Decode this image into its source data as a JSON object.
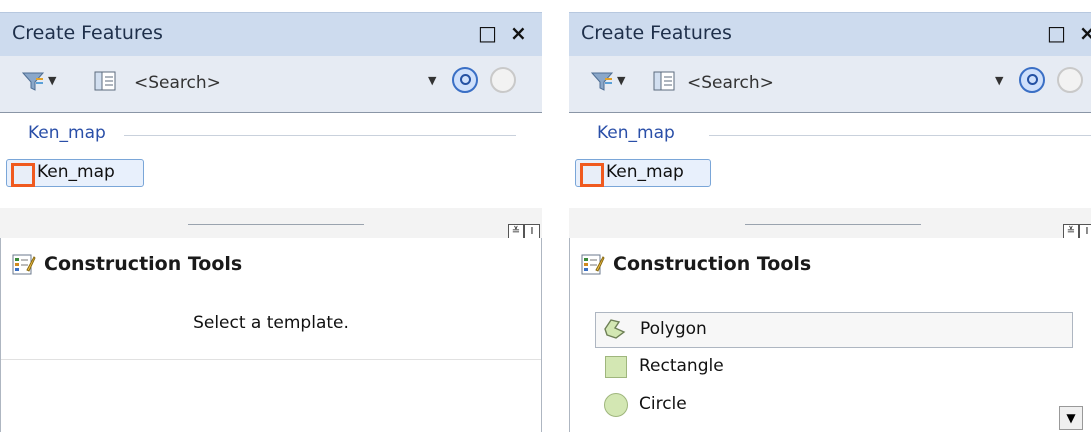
{
  "panels": [
    {
      "title": "Create Features",
      "restore_icon": "□",
      "close_icon": "×",
      "search": {
        "placeholder": "<Search>"
      },
      "template_group": {
        "label": "Ken_map"
      },
      "template_item": {
        "label": "Ken_map"
      },
      "splitter_buttons": [
        "≚",
        "I"
      ],
      "construction_tools": {
        "title": "Construction Tools",
        "message": "Select a template."
      }
    },
    {
      "title": "Create Features",
      "restore_icon": "□",
      "close_icon": "×",
      "search": {
        "placeholder": "<Search>"
      },
      "template_group": {
        "label": "Ken_map"
      },
      "template_item": {
        "label": "Ken_map"
      },
      "splitter_buttons": [
        "≚",
        "I"
      ],
      "construction_tools": {
        "title": "Construction Tools",
        "items": [
          {
            "label": "Polygon",
            "icon": "polygon-icon"
          },
          {
            "label": "Rectangle",
            "icon": "rectangle-icon"
          },
          {
            "label": "Circle",
            "icon": "circle-icon"
          }
        ]
      },
      "scroll_down_icon": "▼"
    }
  ],
  "colors": {
    "title_bar": "#cddbee",
    "toolbar": "#e6ebf3",
    "group_label": "#2a4fa8",
    "highlight": "#f05a1f",
    "tool_fill": "#d3e7b3"
  }
}
